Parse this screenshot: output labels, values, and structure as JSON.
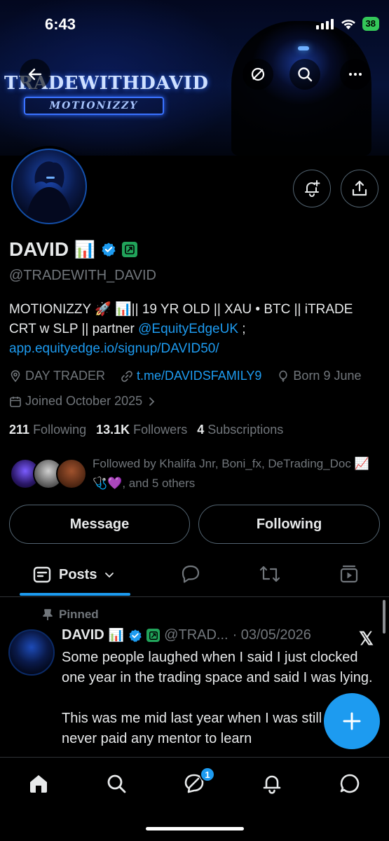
{
  "status_bar": {
    "time": "6:43",
    "battery": "38"
  },
  "banner": {
    "title": "TRADEWITHDAVID",
    "subtitle": "MOTIONIZZY"
  },
  "profile": {
    "name": "DAVID",
    "name_emoji": "📊",
    "handle": "@TRADEWITH_DAVID",
    "bio_line1": "MOTIONIZZY 🚀 📊|| 19 YR OLD || XAU • BTC || iTRADE",
    "bio_line2_prefix": "CRT w SLP || partner ",
    "bio_mention": "@EquityEdgeUK",
    "bio_line2_suffix": " ;",
    "bio_link": "app.equityedge.io/signup/DAVID50/",
    "location": "DAY TRADER",
    "website": "t.me/DAVIDSFAMILY9",
    "born": "Born 9 June",
    "joined": "Joined October 2025",
    "following_count": "211",
    "following_label": "Following",
    "followers_count": "13.1K",
    "followers_label": "Followers",
    "subscriptions_count": "4",
    "subscriptions_label": "Subscriptions",
    "followed_by": "Followed by Khalifa Jnr, Boni_fx, DeTrading_Doc 📈🩺💜, and 5 others"
  },
  "actions": {
    "message": "Message",
    "following": "Following"
  },
  "tabs": {
    "posts": "Posts"
  },
  "post": {
    "pinned_label": "Pinned",
    "author": "DAVID",
    "author_emoji": "📊",
    "handle_truncated": "@TRAD...",
    "date": "· 03/05/2026",
    "x_logo": "𝕏",
    "text": "Some people laughed when I said I just clocked one year in the trading space and said I was lying.\n\nThis was me mid last year when I was still learning, never paid any mentor to learn"
  },
  "nav": {
    "messages_badge": "1"
  },
  "colors": {
    "accent": "#1d9bf0",
    "muted": "#71767b",
    "border": "#536471",
    "verified": "#1d9bf0",
    "affiliate": "#21a35a"
  }
}
